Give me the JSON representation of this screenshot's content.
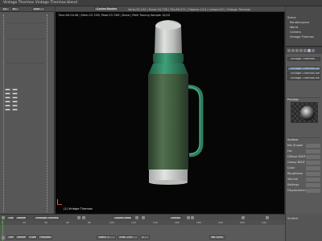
{
  "window": {
    "title": "Vintage Thermos Vintage Thermos.blend"
  },
  "left_panel": {
    "header_left": "Lc",
    "header_mid": "M",
    "header_right": "Add"
  },
  "viewport": {
    "header_mode": "Cycles Render",
    "header_info": "Verts:35,194 | Faces:34,736 | Tris:69,472 | Objects:1/14 | Lamps:0/2 | Vintage Thermos",
    "stats": "Time:00:04.08 | Mem:23.74M, Peak:23.74M | Done | Path Tracing Sample 10/10",
    "object_name": "(1) Vintage Thermos"
  },
  "outliner": {
    "rows": [
      "Scene",
      "RenderLayers",
      "World",
      "Camera",
      "Vintage Thermos"
    ]
  },
  "properties": {
    "material_slots": [
      "Vintage Thermos Green",
      "Vintage Thermos Metal",
      "Vintage Thermos Hand"
    ],
    "selected_material": "Vintage Thermos",
    "preview_label": "Preview",
    "surface_label": "Surface",
    "fields": [
      "Surface",
      "Mix Shader",
      "Fac",
      "Diffuse BSDF",
      "Glossy BSDF",
      "Color",
      "Roughness",
      "Volume",
      "Settings",
      "Displacement"
    ]
  },
  "timeline_header": {
    "view": "View",
    "marker": "Marker",
    "frame": "Frame",
    "playback": "Playback",
    "render_label": "Vintage Thermos",
    "object_mode": "Object Mode",
    "global": "Global"
  },
  "timeline": {
    "ticks": [
      "0",
      "20",
      "40",
      "60",
      "80",
      "100",
      "120",
      "140",
      "160",
      "180",
      "200",
      "220",
      "240"
    ],
    "start": "Start: 1",
    "end": "End: 250",
    "current": "1",
    "no_sync": "No Sync"
  },
  "colors": {
    "body_green": "#3f5b3d",
    "band_green": "#2e7d5d",
    "cap_silver": "#c9ccc9",
    "viewport_bg": "#060606",
    "panel_bg": "#5a5a5a"
  }
}
